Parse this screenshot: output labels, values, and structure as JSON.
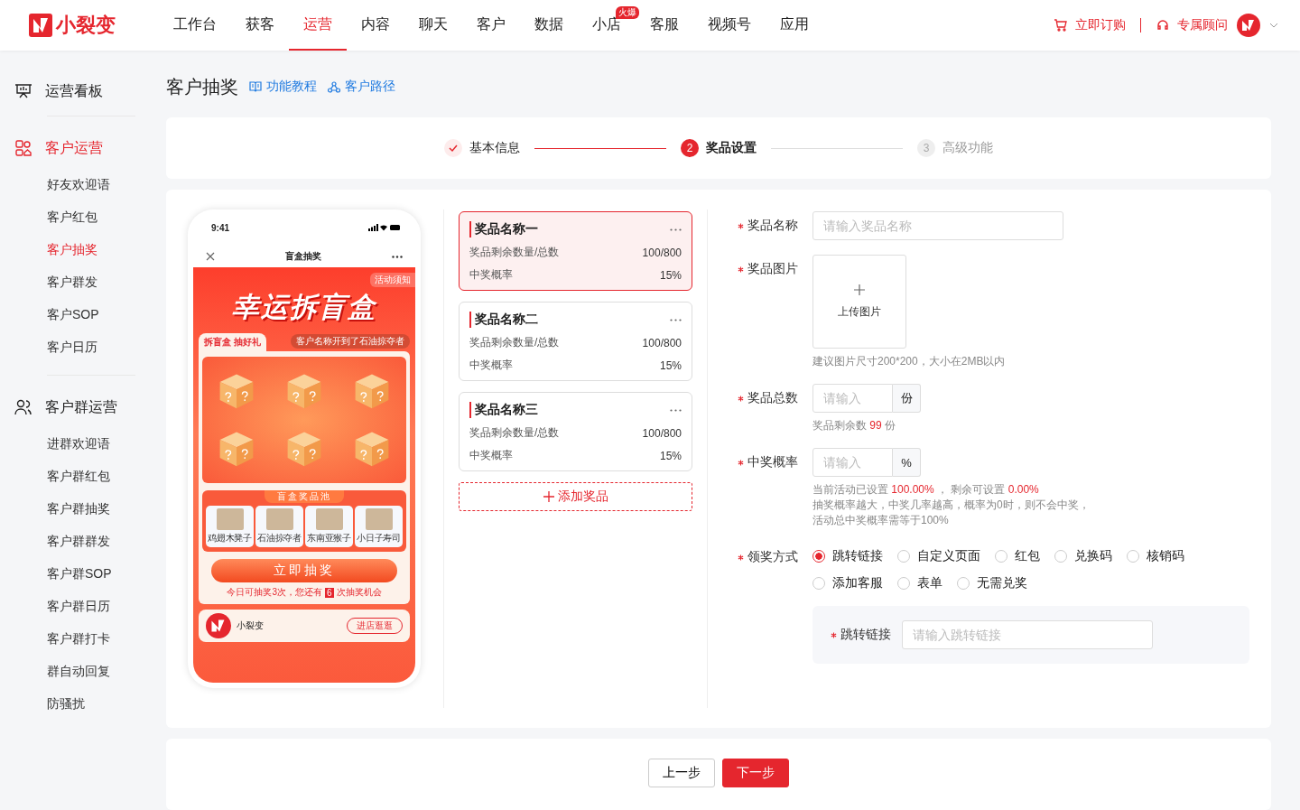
{
  "header": {
    "brand": "小裂变",
    "nav": [
      {
        "label": "工作台",
        "selected": false
      },
      {
        "label": "获客",
        "selected": false
      },
      {
        "label": "运营",
        "selected": true
      },
      {
        "label": "内容",
        "selected": false
      },
      {
        "label": "聊天",
        "selected": false
      },
      {
        "label": "客户",
        "selected": false
      },
      {
        "label": "数据",
        "selected": false
      },
      {
        "label": "小店",
        "selected": false,
        "badge": "火爆"
      },
      {
        "label": "客服",
        "selected": false
      },
      {
        "label": "视频号",
        "selected": false
      },
      {
        "label": "应用",
        "selected": false
      }
    ],
    "order": "立即订购",
    "advisor": "专属顾问"
  },
  "sidebar": {
    "sections": [
      {
        "title": "运营看板",
        "selected": false
      },
      {
        "title": "客户运营",
        "selected": true,
        "items": [
          {
            "label": "好友欢迎语",
            "selected": false
          },
          {
            "label": "客户红包",
            "selected": false
          },
          {
            "label": "客户抽奖",
            "selected": true
          },
          {
            "label": "客户群发",
            "selected": false
          },
          {
            "label": "客户SOP",
            "selected": false
          },
          {
            "label": "客户日历",
            "selected": false
          }
        ]
      },
      {
        "title": "客户群运营",
        "selected": false,
        "items": [
          {
            "label": "进群欢迎语",
            "selected": false
          },
          {
            "label": "客户群红包",
            "selected": false
          },
          {
            "label": "客户群抽奖",
            "selected": false
          },
          {
            "label": "客户群群发",
            "selected": false
          },
          {
            "label": "客户群SOP",
            "selected": false
          },
          {
            "label": "客户群日历",
            "selected": false
          },
          {
            "label": "客户群打卡",
            "selected": false
          },
          {
            "label": "群自动回复",
            "selected": false
          },
          {
            "label": "防骚扰",
            "selected": false
          }
        ]
      }
    ]
  },
  "page": {
    "title": "客户抽奖",
    "links": [
      "功能教程",
      "客户路径"
    ]
  },
  "steps": [
    {
      "label": "基本信息",
      "done": true,
      "selected": false
    },
    {
      "label": "奖品设置",
      "number": "2",
      "done": false,
      "selected": true
    },
    {
      "label": "高级功能",
      "number": "3",
      "done": false,
      "selected": false
    }
  ],
  "preview": {
    "time": "9:41",
    "title": "盲盒抽奖",
    "notice": "活动须知",
    "banner": "幸运拆盲盒",
    "tab": "拆盲盒 抽好礼",
    "ticker": "客户名称开到了石油掠夺者",
    "pool_title": "盲盒奖品池",
    "pool": [
      "鸡翅木凳子",
      "石油掠夺者",
      "东南亚猴子",
      "小日子寿司"
    ],
    "draw_button": "立即抽奖",
    "chances_before": "今日可抽奖3次，您还有",
    "chances_count": "6",
    "chances_after": "次抽奖机会",
    "shop": "小裂变",
    "shop_button": "进店逛逛"
  },
  "prizes": [
    {
      "name": "奖品名称一",
      "selected": true,
      "stock_label": "奖品剩余数量/总数",
      "stock": "100/800",
      "rate_label": "中奖概率",
      "rate": "15%"
    },
    {
      "name": "奖品名称二",
      "selected": false,
      "stock_label": "奖品剩余数量/总数",
      "stock": "100/800",
      "rate_label": "中奖概率",
      "rate": "15%"
    },
    {
      "name": "奖品名称三",
      "selected": false,
      "stock_label": "奖品剩余数量/总数",
      "stock": "100/800",
      "rate_label": "中奖概率",
      "rate": "15%"
    }
  ],
  "add_prize": "添加奖品",
  "form": {
    "name": {
      "label": "奖品名称",
      "placeholder": "请输入奖品名称"
    },
    "image": {
      "label": "奖品图片",
      "upload": "上传图片",
      "hint": "建议图片尺寸200*200，大小在2MB以内"
    },
    "total": {
      "label": "奖品总数",
      "placeholder": "请输入",
      "unit": "份",
      "hint_before": "奖品剩余数",
      "hint_value": "99",
      "hint_after": "份"
    },
    "rate": {
      "label": "中奖概率",
      "placeholder": "请输入",
      "unit": "%",
      "set_label": "当前活动已设置",
      "set_value": "100.00%",
      "left_label": "，  剩余可设置",
      "left_value": "0.00%",
      "notes": [
        "抽奖概率越大，中奖几率越高，概率为0时，则不会中奖，",
        "活动总中奖概率需等于100%"
      ]
    },
    "method": {
      "label": "领奖方式",
      "options": [
        {
          "label": "跳转链接",
          "selected": true
        },
        {
          "label": "自定义页面",
          "selected": false
        },
        {
          "label": "红包",
          "selected": false
        },
        {
          "label": "兑换码",
          "selected": false
        },
        {
          "label": "核销码",
          "selected": false
        },
        {
          "label": "添加客服",
          "selected": false
        },
        {
          "label": "表单",
          "selected": false
        },
        {
          "label": "无需兑奖",
          "selected": false
        }
      ]
    },
    "link": {
      "label": "跳转链接",
      "placeholder": "请输入跳转链接"
    }
  },
  "footer": {
    "prev": "上一步",
    "next": "下一步"
  }
}
